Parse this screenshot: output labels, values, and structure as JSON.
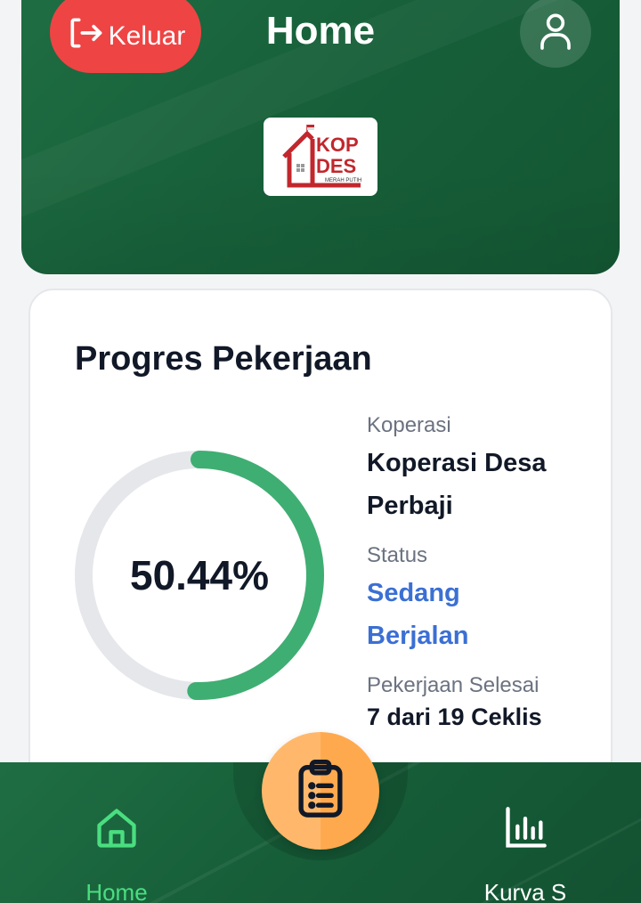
{
  "header": {
    "logout_label": "Keluar",
    "title": "Home",
    "logo": {
      "line1": "KOP",
      "line2": "DES",
      "tagline": "MERAH PUTIH"
    }
  },
  "progress": {
    "heading": "Progres Pekerjaan",
    "percent_text": "50.44%",
    "percent_value": 50.44,
    "colors": {
      "track": "#e5e7eb",
      "fill": "#3fae72",
      "status": "#3b6fd4"
    }
  },
  "details": {
    "koperasi_label": "Koperasi",
    "koperasi_line1": "Koperasi Desa",
    "koperasi_line2": "Perbaji",
    "status_label": "Status",
    "status_line1": "Sedang",
    "status_line2": "Berjalan",
    "done_label": "Pekerjaan Selesai",
    "done_value": "7 dari 19 Ceklis"
  },
  "nav": {
    "home_label": "Home",
    "kurva_label": "Kurva S"
  },
  "icons": {
    "logout": "logout-icon",
    "profile": "user-icon",
    "home": "home-icon",
    "clipboard": "clipboard-icon",
    "chart": "bar-chart-icon"
  }
}
